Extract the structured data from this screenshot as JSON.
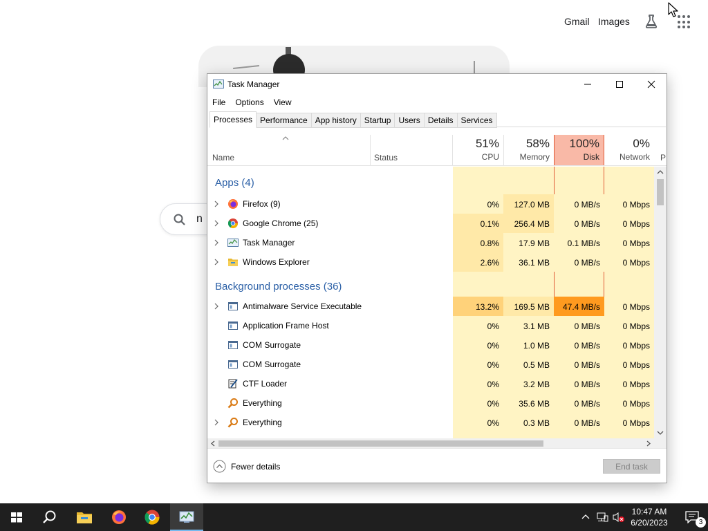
{
  "google": {
    "gmail": "Gmail",
    "images": "Images",
    "search_text": "n",
    "icons": [
      "flask-icon",
      "apps-grid-icon",
      "search-icon"
    ]
  },
  "window": {
    "title": "Task Manager",
    "menu": [
      "File",
      "Options",
      "View"
    ],
    "tabs": [
      "Processes",
      "Performance",
      "App history",
      "Startup",
      "Users",
      "Details",
      "Services"
    ],
    "active_tab": "Processes"
  },
  "columns": {
    "name": "Name",
    "status": "Status",
    "cpu": {
      "pct": "51%",
      "label": "CPU"
    },
    "memory": {
      "pct": "58%",
      "label": "Memory"
    },
    "disk": {
      "pct": "100%",
      "label": "Disk"
    },
    "network": {
      "pct": "0%",
      "label": "Network"
    },
    "power": "P"
  },
  "groups": {
    "apps": "Apps (4)",
    "background": "Background processes (36)"
  },
  "apps": [
    {
      "name": "Firefox (9)",
      "icon": "firefox-icon",
      "expandable": true,
      "cpu": "0%",
      "mem": "127.0 MB",
      "disk": "0 MB/s",
      "net": "0 Mbps"
    },
    {
      "name": "Google Chrome (25)",
      "icon": "chrome-icon",
      "expandable": true,
      "cpu": "0.1%",
      "mem": "256.4 MB",
      "disk": "0 MB/s",
      "net": "0 Mbps"
    },
    {
      "name": "Task Manager",
      "icon": "task-manager-icon",
      "expandable": true,
      "cpu": "0.8%",
      "mem": "17.9 MB",
      "disk": "0.1 MB/s",
      "net": "0 Mbps"
    },
    {
      "name": "Windows Explorer",
      "icon": "folder-icon",
      "expandable": true,
      "cpu": "2.6%",
      "mem": "36.1 MB",
      "disk": "0 MB/s",
      "net": "0 Mbps"
    }
  ],
  "background": [
    {
      "name": "Antimalware Service Executable",
      "icon": "service-icon",
      "expandable": true,
      "cpu": "13.2%",
      "mem": "169.5 MB",
      "disk": "47.4 MB/s",
      "net": "0 Mbps"
    },
    {
      "name": "Application Frame Host",
      "icon": "service-icon",
      "expandable": false,
      "cpu": "0%",
      "mem": "3.1 MB",
      "disk": "0 MB/s",
      "net": "0 Mbps"
    },
    {
      "name": "COM Surrogate",
      "icon": "service-icon",
      "expandable": false,
      "cpu": "0%",
      "mem": "1.0 MB",
      "disk": "0 MB/s",
      "net": "0 Mbps"
    },
    {
      "name": "COM Surrogate",
      "icon": "service-icon",
      "expandable": false,
      "cpu": "0%",
      "mem": "0.5 MB",
      "disk": "0 MB/s",
      "net": "0 Mbps"
    },
    {
      "name": "CTF Loader",
      "icon": "ctf-loader-icon",
      "expandable": false,
      "cpu": "0%",
      "mem": "3.2 MB",
      "disk": "0 MB/s",
      "net": "0 Mbps"
    },
    {
      "name": "Everything",
      "icon": "everything-icon",
      "expandable": false,
      "cpu": "0%",
      "mem": "35.6 MB",
      "disk": "0 MB/s",
      "net": "0 Mbps"
    },
    {
      "name": "Everything",
      "icon": "everything-icon",
      "expandable": true,
      "cpu": "0%",
      "mem": "0.3 MB",
      "disk": "0 MB/s",
      "net": "0 Mbps"
    }
  ],
  "footer": {
    "fewer_details": "Fewer details",
    "end_task": "End task"
  },
  "taskbar": {
    "items": [
      "windows-start-icon",
      "search-icon",
      "file-explorer-icon",
      "firefox-icon",
      "chrome-icon",
      "task-manager-icon"
    ],
    "active": "task-manager-icon",
    "time": "10:47 AM",
    "date": "6/20/2023",
    "notification_count": "3"
  },
  "colors": {
    "disk_header": "#f9b9a7",
    "heat_low": "#fff4c4",
    "heat_mid": "#ffe9a8",
    "heat_high": "#ffd27a",
    "heat_disk_high": "#ff9a1f",
    "group_text": "#2a5fa6"
  }
}
